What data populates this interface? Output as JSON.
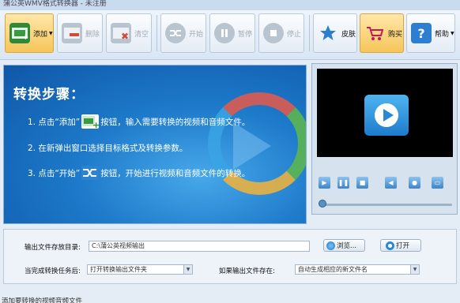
{
  "window": {
    "title": "蒲公英WMV格式转换器 - 未注册"
  },
  "toolbar": {
    "add": "添加",
    "delete": "删除",
    "clear": "清空",
    "start": "开始",
    "pause": "暂停",
    "stop": "停止",
    "skin": "皮肤",
    "buy": "购买",
    "help": "帮助"
  },
  "banner": {
    "heading": "转换步骤：",
    "step1_a": "1. 点击“添加”",
    "step1_b": "按钮，输入需要转换的视频和音频文件。",
    "step2": "2. 在新弹出窗口选择目标格式及转换参数。",
    "step3_a": "3. 点击“开始”",
    "step3_b": "按钮，开始进行视频和音频文件的转换。"
  },
  "player": {
    "icons": [
      "play-icon",
      "pause-icon",
      "stop-icon",
      "volume-icon",
      "snapshot-icon",
      "fullscreen-icon"
    ]
  },
  "settings": {
    "output_dir_label": "输出文件存放目录:",
    "output_dir_value": "C:\\蒲公英视频输出",
    "browse": "浏览...",
    "open": "打开",
    "after_done_label": "当完成转换任务后:",
    "after_done_value": "打开转换输出文件夹",
    "if_exists_label": "如果输出文件存在:",
    "if_exists_value": "自动生成相应的新文件名"
  },
  "status": {
    "text": "添加要转换的视频音频文件"
  },
  "colors": {
    "accent": "#1d79c9",
    "hot": "#f6c55a"
  }
}
